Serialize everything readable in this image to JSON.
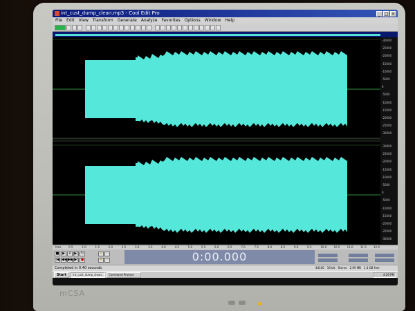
{
  "window": {
    "title": "int_cust_dump_clean.mp3 - Cool Edit Pro",
    "buttons": {
      "minimize": "_",
      "maximize": "□",
      "close": "×"
    }
  },
  "menu": {
    "items": [
      "File",
      "Edit",
      "View",
      "Transform",
      "Generate",
      "Analyze",
      "Favorites",
      "Options",
      "Window",
      "Help"
    ]
  },
  "colors": {
    "waveform": "#55e8da",
    "wave_background": "#000000",
    "time_display_bg": "#7f8aa8",
    "title_bar": "#0a1a7a"
  },
  "ruler": {
    "top": [
      "-30000",
      "-25000",
      "-20000",
      "-15000",
      "-10000",
      "-5000",
      "0",
      "-5000",
      "-10000",
      "-15000",
      "-20000",
      "-25000",
      "-30000"
    ],
    "bottom": [
      "-30000",
      "-25000",
      "-20000",
      "-15000",
      "-10000",
      "-5000",
      "0",
      "-5000",
      "-10000",
      "-15000",
      "-20000",
      "-25000",
      "-30000"
    ]
  },
  "timeline": {
    "labels": [
      "hms",
      "0.5",
      "1.0",
      "1.5",
      "2.0",
      "2.5",
      "3.0",
      "3.5",
      "4.0",
      "4.5",
      "5.0",
      "5.5",
      "6.0",
      "6.5",
      "7.0",
      "7.5",
      "8.0",
      "8.5",
      "9.0",
      "9.5",
      "10.0",
      "10.5",
      "11.0",
      "11.5",
      "12.0"
    ]
  },
  "transport": {
    "time_display": "0:00.000",
    "buttons": [
      "■",
      "▶",
      "⏸",
      "▶|",
      "↻",
      "|◀",
      "◀◀",
      "▶▶",
      "▶|",
      "●"
    ],
    "zoom_buttons": [
      "+",
      "-",
      "+",
      "-"
    ]
  },
  "status": {
    "message": "Completed in 0.40 seconds",
    "items": [
      "44100",
      "16-bit",
      "Stereo",
      "2.09 MB",
      "1.4 GB free"
    ]
  },
  "taskbar": {
    "start": "Start",
    "tasks": [
      "int_cust_dump_clean...",
      "Command Prompt"
    ],
    "clock": "4:26 PM"
  },
  "monitor": {
    "brand": "mCSA"
  }
}
